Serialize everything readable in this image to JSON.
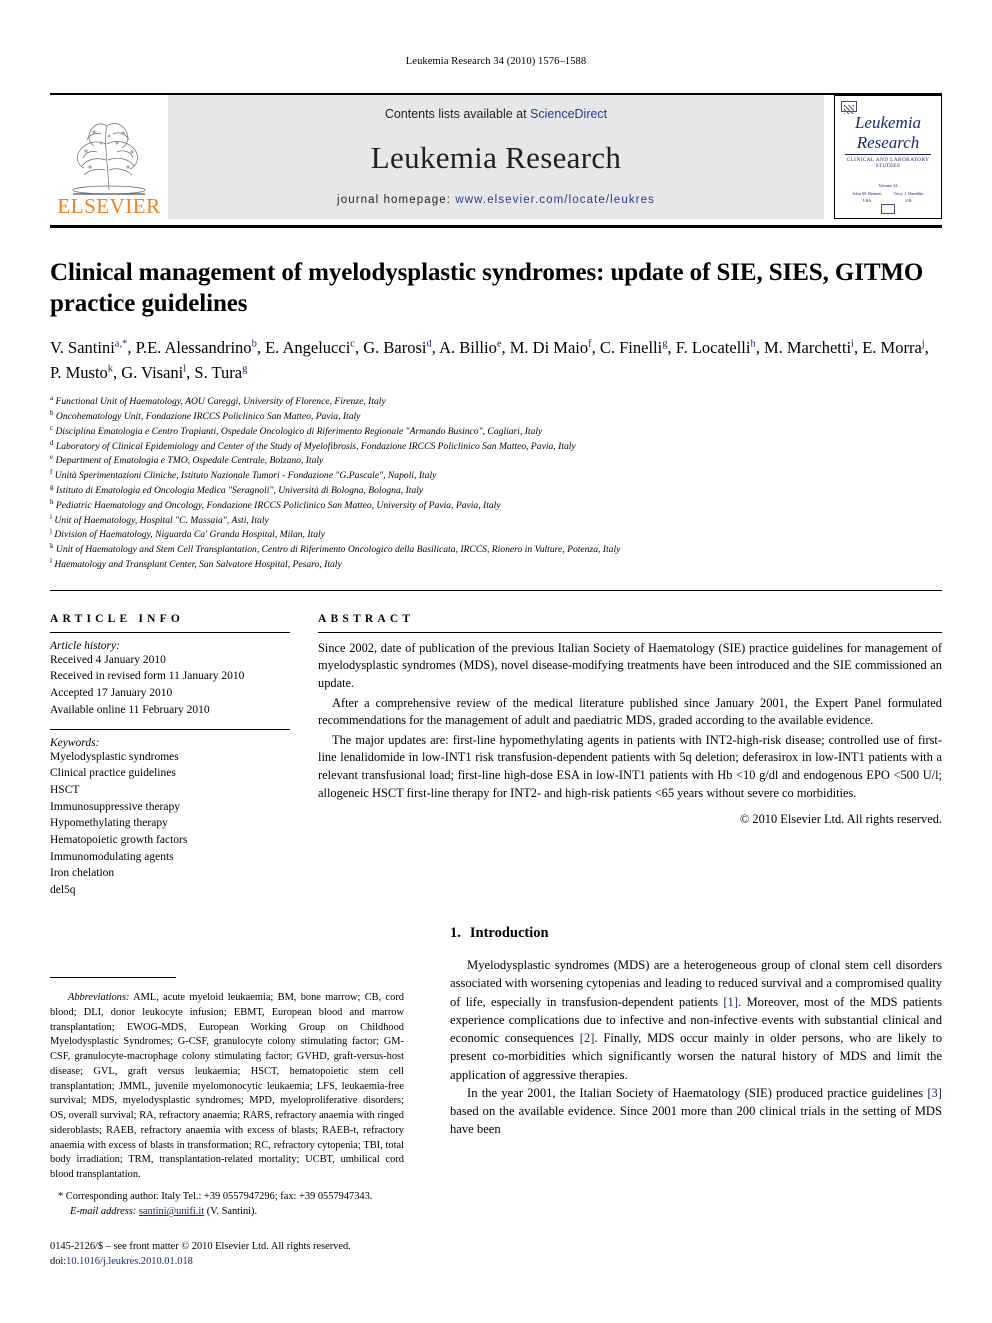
{
  "running_head": "Leukemia Research 34 (2010) 1576–1588",
  "header": {
    "contents_prefix": "Contents lists available at ",
    "sciencedirect": "ScienceDirect",
    "journal_title": "Leukemia Research",
    "homepage_prefix": "journal homepage: ",
    "homepage_url": "www.elsevier.com/locate/leukres",
    "publisher_logo_text": "ELSEVIER",
    "cover": {
      "line1": "Leukemia",
      "line2": "Research",
      "subtitle": "CLINICAL AND LABORATORY STUDIES",
      "mid_line": "Volume 34",
      "editor_1_name": "John M. Bennett",
      "editor_1_loc": "USA",
      "editor_2_name": "Terry J. Hamblin",
      "editor_2_loc": "UK"
    },
    "colors": {
      "elsevier_orange": "#F47D20",
      "link_blue": "#2a3b8f",
      "band_grey": "#e6e7e8"
    }
  },
  "title": "Clinical management of myelodysplastic syndromes: update of SIE, SIES, GITMO practice guidelines",
  "authors_line1": "V. Santini",
  "authors": [
    {
      "name": "V. Santini",
      "sup": "a,*"
    },
    {
      "name": "P.E. Alessandrino",
      "sup": "b"
    },
    {
      "name": "E. Angelucci",
      "sup": "c"
    },
    {
      "name": "G. Barosi",
      "sup": "d"
    },
    {
      "name": "A. Billio",
      "sup": "e"
    },
    {
      "name": "M. Di Maio",
      "sup": "f"
    },
    {
      "name": "C. Finelli",
      "sup": "g"
    },
    {
      "name": "F. Locatelli",
      "sup": "h"
    },
    {
      "name": "M. Marchetti",
      "sup": "i"
    },
    {
      "name": "E. Morra",
      "sup": "j"
    },
    {
      "name": "P. Musto",
      "sup": "k"
    },
    {
      "name": "G. Visani",
      "sup": "l"
    },
    {
      "name": "S. Tura",
      "sup": "g"
    }
  ],
  "affiliations": [
    {
      "mark": "a",
      "text": "Functional Unit of Haematology, AOU Careggi, University of Florence, Firenze, Italy"
    },
    {
      "mark": "b",
      "text": "Oncohematology Unit, Fondazione IRCCS Policlinico San Matteo, Pavia, Italy"
    },
    {
      "mark": "c",
      "text": "Disciplina Ematologia e Centro Trapianti, Ospedale Oncologico di Riferimento Regionale \"Armando Businco\", Cagliari, Italy"
    },
    {
      "mark": "d",
      "text": "Laboratory of Clinical Epidemiology and Center of the Study of Myelofibrosis, Fondazione IRCCS Policlinico San Matteo, Pavia, Italy"
    },
    {
      "mark": "e",
      "text": "Department of Ematologia e TMO, Ospedale Centrale, Bolzano, Italy"
    },
    {
      "mark": "f",
      "text": "Unità Sperimentazioni Cliniche, Istituto Nazionale Tumori - Fondazione \"G.Pascale\", Napoli, Italy"
    },
    {
      "mark": "g",
      "text": "Istituto di Ematologia ed Oncologia Medica \"Seragnoli\", Università di Bologna, Bologna, Italy"
    },
    {
      "mark": "h",
      "text": "Pediatric Haematology and Oncology, Fondazione IRCCS Policlinico San Matteo, University of Pavia, Pavia, Italy"
    },
    {
      "mark": "i",
      "text": "Unit of Haematology, Hospital \"C. Massaia\", Asti, Italy"
    },
    {
      "mark": "j",
      "text": "Division of Haematology, Niguarda Ca' Granda Hospital, Milan, Italy"
    },
    {
      "mark": "k",
      "text": "Unit of Haematology and Stem Cell Transplantation, Centro di Riferimento Oncologico della Basilicata, IRCCS, Rionero in Vulture, Potenza, Italy"
    },
    {
      "mark": "l",
      "text": "Haematology and Transplant Center, San Salvatore Hospital, Pesaro, Italy"
    }
  ],
  "article_info": {
    "heading": "ARTICLE INFO",
    "history_label": "Article history:",
    "history": [
      "Received 4 January 2010",
      "Received in revised form 11 January 2010",
      "Accepted 17 January 2010",
      "Available online 11 February 2010"
    ],
    "keywords_label": "Keywords:",
    "keywords": [
      "Myelodysplastic syndromes",
      "Clinical practice guidelines",
      "HSCT",
      "Immunosuppressive therapy",
      "Hypomethylating therapy",
      "Hematopoietic growth factors",
      "Immunomodulating agents",
      "Iron chelation",
      "del5q"
    ]
  },
  "abstract": {
    "heading": "ABSTRACT",
    "paragraphs": [
      "Since 2002, date of publication of the previous Italian Society of Haematology (SIE) practice guidelines for management of myelodysplastic syndromes (MDS), novel disease-modifying treatments have been introduced and the SIE commissioned an update.",
      "After a comprehensive review of the medical literature published since January 2001, the Expert Panel formulated recommendations for the management of adult and paediatric MDS, graded according to the available evidence.",
      "The major updates are: first-line hypomethylating agents in patients with INT2-high-risk disease; controlled use of first-line lenalidomide in low-INT1 risk transfusion-dependent patients with 5q deletion; deferasirox in low-INT1 patients with a relevant transfusional load; first-line high-dose ESA in low-INT1 patients with Hb <10 g/dl and endogenous EPO <500 U/l; allogeneic HSCT first-line therapy for INT2- and high-risk patients <65 years without severe co morbidities."
    ],
    "copyright": "© 2010 Elsevier Ltd. All rights reserved."
  },
  "footnotes": {
    "abbreviations_label": "Abbreviations:",
    "abbreviations_text": "AML, acute myeloid leukaemia; BM, bone marrow; CB, cord blood; DLI, donor leukocyte infusion; EBMT, European blood and marrow transplantation; EWOG-MDS, European Working Group on Childhood Myelodysplastic Syndromes; G-CSF, granulocyte colony stimulating factor; GM-CSF, granulocyte-macrophage colony stimulating factor; GVHD, graft-versus-host disease; GVL, graft versus leukaemia; HSCT, hematopoietic stem cell transplantation; JMML, juvenile myelomonocytic leukaemia; LFS, leukaemia-free survival; MDS, myelodysplastic syndromes; MPD, myeloproliferative disorders; OS, overall survival; RA, refractory anaemia; RARS, refractory anaemia with ringed sideroblasts; RAEB, refractory anaemia with excess of blasts; RAEB-t, refractory anaemia with excess of blasts in transformation; RC, refractory cytopenia; TBI, total body irradiation; TRM, transplantation-related mortality; UCBT, umbilical cord blood transplantation.",
    "corresponding": "* Corresponding author. Italy Tel.: +39 0557947296; fax: +39 0557947343.",
    "email_label": "E-mail address:",
    "email": "santini@unifi.it",
    "email_suffix": "(V. Santini).",
    "issn_line": "0145-2126/$ – see front matter © 2010 Elsevier Ltd. All rights reserved.",
    "doi_prefix": "doi:",
    "doi": "10.1016/j.leukres.2010.01.018"
  },
  "introduction": {
    "number": "1.",
    "heading": "Introduction",
    "paragraphs": [
      "Myelodysplastic syndromes (MDS) are a heterogeneous group of clonal stem cell disorders associated with worsening cytopenias and leading to reduced survival and a compromised quality of life, especially in transfusion-dependent patients [1]. Moreover, most of the MDS patients experience complications due to infective and non-infective events with substantial clinical and economic consequences [2]. Finally, MDS occur mainly in older persons, who are likely to present co-morbidities which significantly worsen the natural history of MDS and limit the application of aggressive therapies.",
      "In the year 2001, the Italian Society of Haematology (SIE) produced practice guidelines [3] based on the available evidence. Since 2001 more than 200 clinical trials in the setting of MDS have been"
    ]
  }
}
